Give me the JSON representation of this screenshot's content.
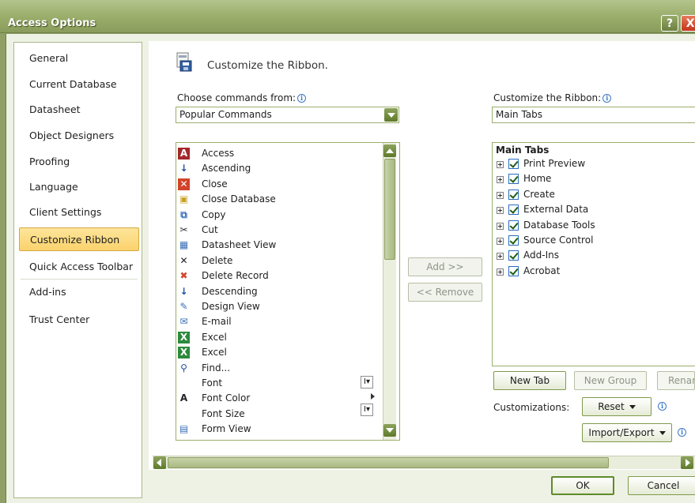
{
  "window": {
    "title": "Access Options",
    "help_glyph": "?",
    "close_glyph": "X"
  },
  "nav": {
    "items": [
      {
        "label": "General"
      },
      {
        "label": "Current Database"
      },
      {
        "label": "Datasheet"
      },
      {
        "label": "Object Designers"
      },
      {
        "label": "Proofing"
      },
      {
        "label": "Language"
      },
      {
        "label": "Client Settings"
      },
      {
        "label": "Customize Ribbon"
      },
      {
        "label": "Quick Access Toolbar"
      },
      {
        "label": "Add-ins"
      },
      {
        "label": "Trust Center"
      }
    ],
    "selected": "Customize Ribbon"
  },
  "header": {
    "title": "Customize the Ribbon."
  },
  "left_panel": {
    "label": "Choose commands from:",
    "combo_value": "Popular Commands",
    "commands": [
      {
        "label": "Access",
        "icon": "access-icon"
      },
      {
        "label": "Ascending",
        "icon": "sort-ascending-icon"
      },
      {
        "label": "Close",
        "icon": "close-icon"
      },
      {
        "label": "Close Database",
        "icon": "close-database-icon"
      },
      {
        "label": "Copy",
        "icon": "copy-icon"
      },
      {
        "label": "Cut",
        "icon": "cut-icon"
      },
      {
        "label": "Datasheet View",
        "icon": "datasheet-view-icon"
      },
      {
        "label": "Delete",
        "icon": "delete-icon"
      },
      {
        "label": "Delete Record",
        "icon": "delete-record-icon"
      },
      {
        "label": "Descending",
        "icon": "sort-descending-icon"
      },
      {
        "label": "Design View",
        "icon": "design-view-icon"
      },
      {
        "label": "E-mail",
        "icon": "email-icon"
      },
      {
        "label": "Excel",
        "icon": "excel-export-icon"
      },
      {
        "label": "Excel",
        "icon": "excel-import-icon"
      },
      {
        "label": "Find...",
        "icon": "find-icon"
      },
      {
        "label": "Font",
        "icon": ""
      },
      {
        "label": "Font Color",
        "icon": "font-color-icon"
      },
      {
        "label": "Font Size",
        "icon": ""
      },
      {
        "label": "Form View",
        "icon": "form-view-icon"
      }
    ]
  },
  "middle": {
    "add_label": "Add >>",
    "remove_label": "<< Remove"
  },
  "right_panel": {
    "label": "Customize the Ribbon:",
    "combo_value": "Main Tabs",
    "tree_header": "Main Tabs",
    "tabs": [
      {
        "label": "Print Preview",
        "checked": true
      },
      {
        "label": "Home",
        "checked": true
      },
      {
        "label": "Create",
        "checked": true
      },
      {
        "label": "External Data",
        "checked": true
      },
      {
        "label": "Database Tools",
        "checked": true
      },
      {
        "label": "Source Control",
        "checked": true
      },
      {
        "label": "Add-Ins",
        "checked": true
      },
      {
        "label": "Acrobat",
        "checked": true
      }
    ],
    "new_tab_label": "New Tab",
    "new_group_label": "New Group",
    "rename_label": "Rename...",
    "customizations_label": "Customizations:",
    "reset_label": "Reset",
    "import_export_label": "Import/Export"
  },
  "footer": {
    "ok_label": "OK",
    "cancel_label": "Cancel"
  },
  "colors": {
    "titlebar": "#9bae6b",
    "accent": "#5f7a2b",
    "selected_nav": "#fbd26d"
  }
}
